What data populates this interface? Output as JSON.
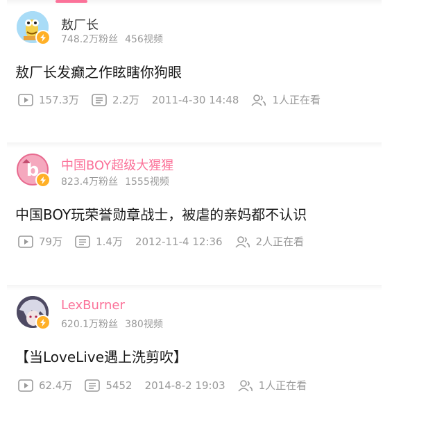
{
  "videos": [
    {
      "uploader": {
        "name": "敖厂长",
        "followers": "748.2万粉丝",
        "video_count": "456视频"
      },
      "title": "敖厂长发癫之作眩瞎你狗眼",
      "plays": "157.3万",
      "danmaku": "2.2万",
      "date": "2011-4-30 14:48",
      "watching": "1人正在看"
    },
    {
      "uploader": {
        "name": "中国BOY超级大猩猩",
        "followers": "823.4万粉丝",
        "video_count": "1555视频"
      },
      "title": "中国BOY玩荣誉勋章战士，被虐的亲妈都不认识",
      "plays": "79万",
      "danmaku": "1.4万",
      "date": "2012-11-4 12:36",
      "watching": "2人正在看"
    },
    {
      "uploader": {
        "name": "LexBurner",
        "followers": "620.1万粉丝",
        "video_count": "380视频"
      },
      "title": "【当LoveLive遇上洗剪吹】",
      "plays": "62.4万",
      "danmaku": "5452",
      "date": "2014-8-2 19:03",
      "watching": "1人正在看"
    }
  ],
  "icons": {
    "plays": "play-icon",
    "danmaku": "danmaku-icon",
    "watching": "watching-icon",
    "verified": "verified-bolt-icon"
  },
  "colors": {
    "accent_pink": "#fb7299",
    "verified_badge": "#ffb027",
    "meta_gray": "#999999",
    "title_text": "#1a1a1a"
  }
}
